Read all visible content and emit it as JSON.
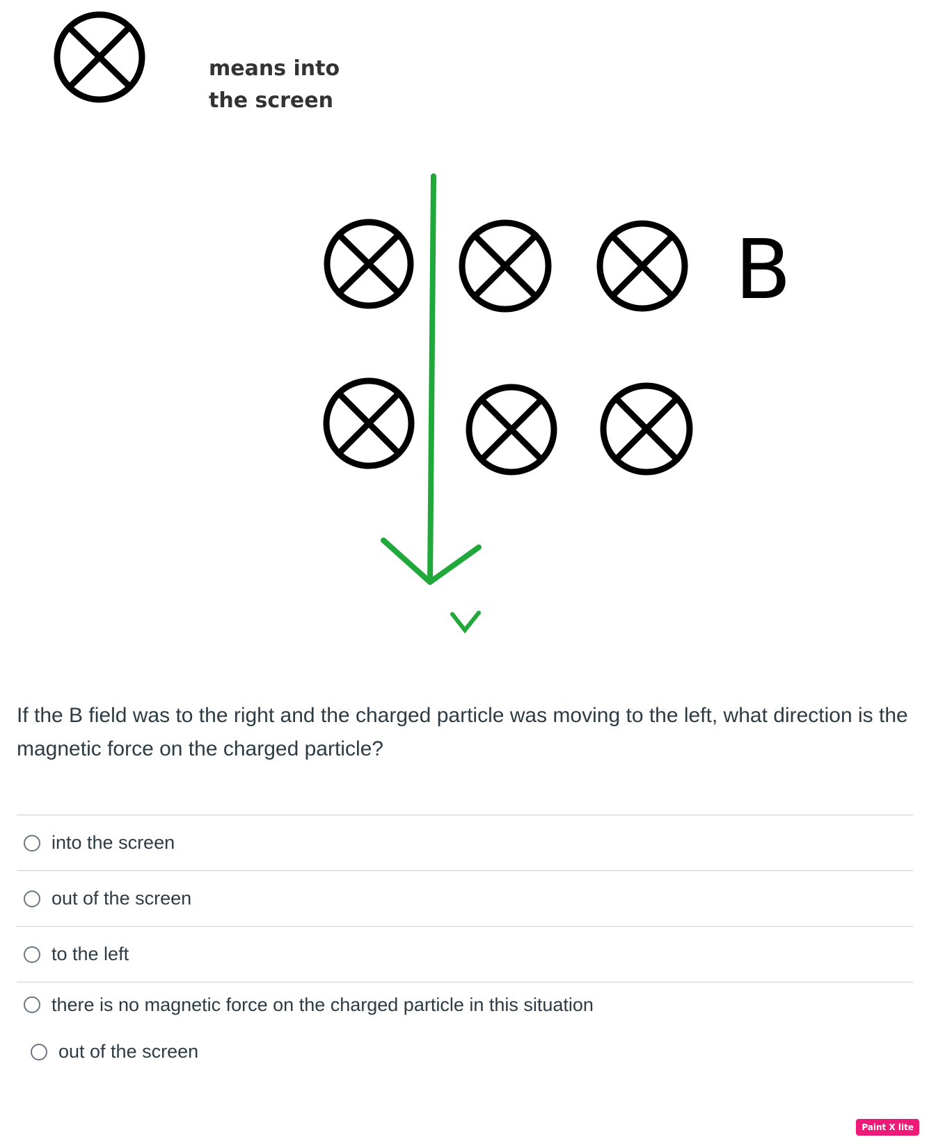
{
  "legend": {
    "text": "means into the screen"
  },
  "diagram": {
    "field_label": "B",
    "velocity_label": "v",
    "arrow_color": "#21a83a"
  },
  "question": {
    "text": "If the B field was to the right and the charged particle was moving to the left, what direction is the magnetic force on the charged particle?"
  },
  "answers": [
    {
      "label": "into the screen"
    },
    {
      "label": "out of the screen"
    },
    {
      "label": "to the left"
    },
    {
      "label": "there is no magnetic force on the charged particle in this situation"
    }
  ],
  "extra_option": {
    "label": "out of the screen"
  },
  "watermark": {
    "text": "Paint X lite"
  }
}
